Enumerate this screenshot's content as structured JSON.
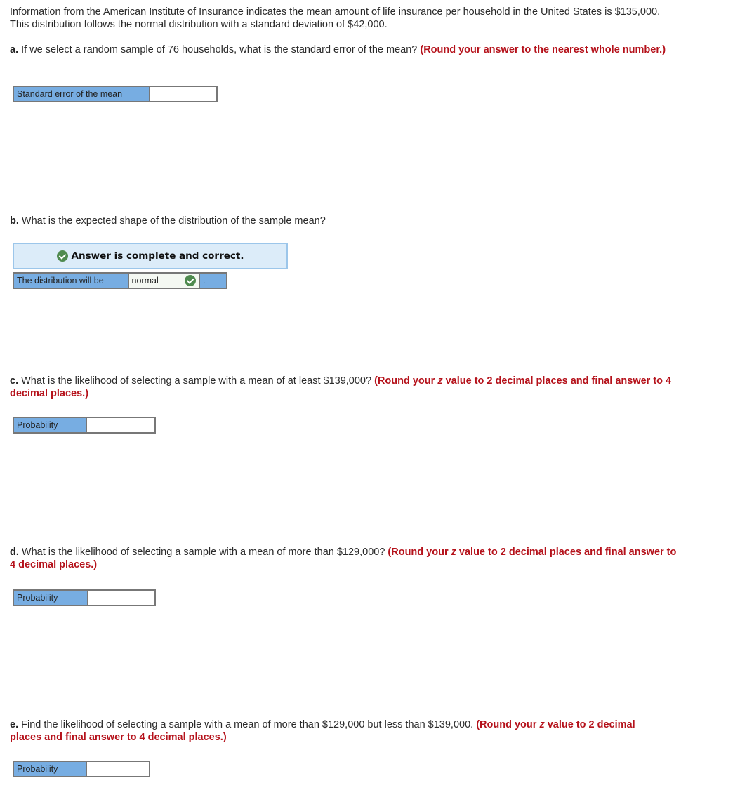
{
  "intro": "Information from the American Institute of Insurance indicates the mean amount of life insurance per household in the United States is $135,000. This distribution follows the normal distribution with a standard deviation of $42,000.",
  "questions": {
    "a": {
      "label": "a.",
      "text": " If we select a random sample of 76 households, what is the standard error of the mean? ",
      "hint": "(Round your answer to the nearest whole number.)",
      "row_label": "Standard error of the mean",
      "value": ""
    },
    "b": {
      "label": "b.",
      "text": " What is the expected shape of the distribution of the sample mean?",
      "banner": "Answer is complete and correct.",
      "row_label": "The distribution will be",
      "value": "normal",
      "suffix": "."
    },
    "c": {
      "label": "c.",
      "text": " What is the likelihood of selecting a sample with a mean of at least $139,000? ",
      "hint_pre": "(Round your ",
      "hint_z": "z",
      "hint_post": " value to 2 decimal places and final answer to 4 decimal places.)",
      "row_label": "Probability",
      "value": ""
    },
    "d": {
      "label": "d.",
      "text": " What is the likelihood of selecting a sample with a mean of more than $129,000? ",
      "hint_pre": "(Round your ",
      "hint_z": "z",
      "hint_post": " value to 2 decimal places and final answer to 4 decimal places.)",
      "row_label": "Probability",
      "value": ""
    },
    "e": {
      "label": "e.",
      "text": " Find the likelihood of selecting a sample with a mean of more than $129,000 but less than $139,000. ",
      "hint_pre": "(Round your ",
      "hint_z": "z",
      "hint_post": " value to 2 decimal places and final answer to 4 decimal places.)",
      "row_label": "Probability",
      "value": ""
    }
  },
  "colors": {
    "hint_red": "#b5121b",
    "label_blue": "#77ade2",
    "banner_bg": "#dcecf9",
    "check_green": "#4f8a4f"
  }
}
